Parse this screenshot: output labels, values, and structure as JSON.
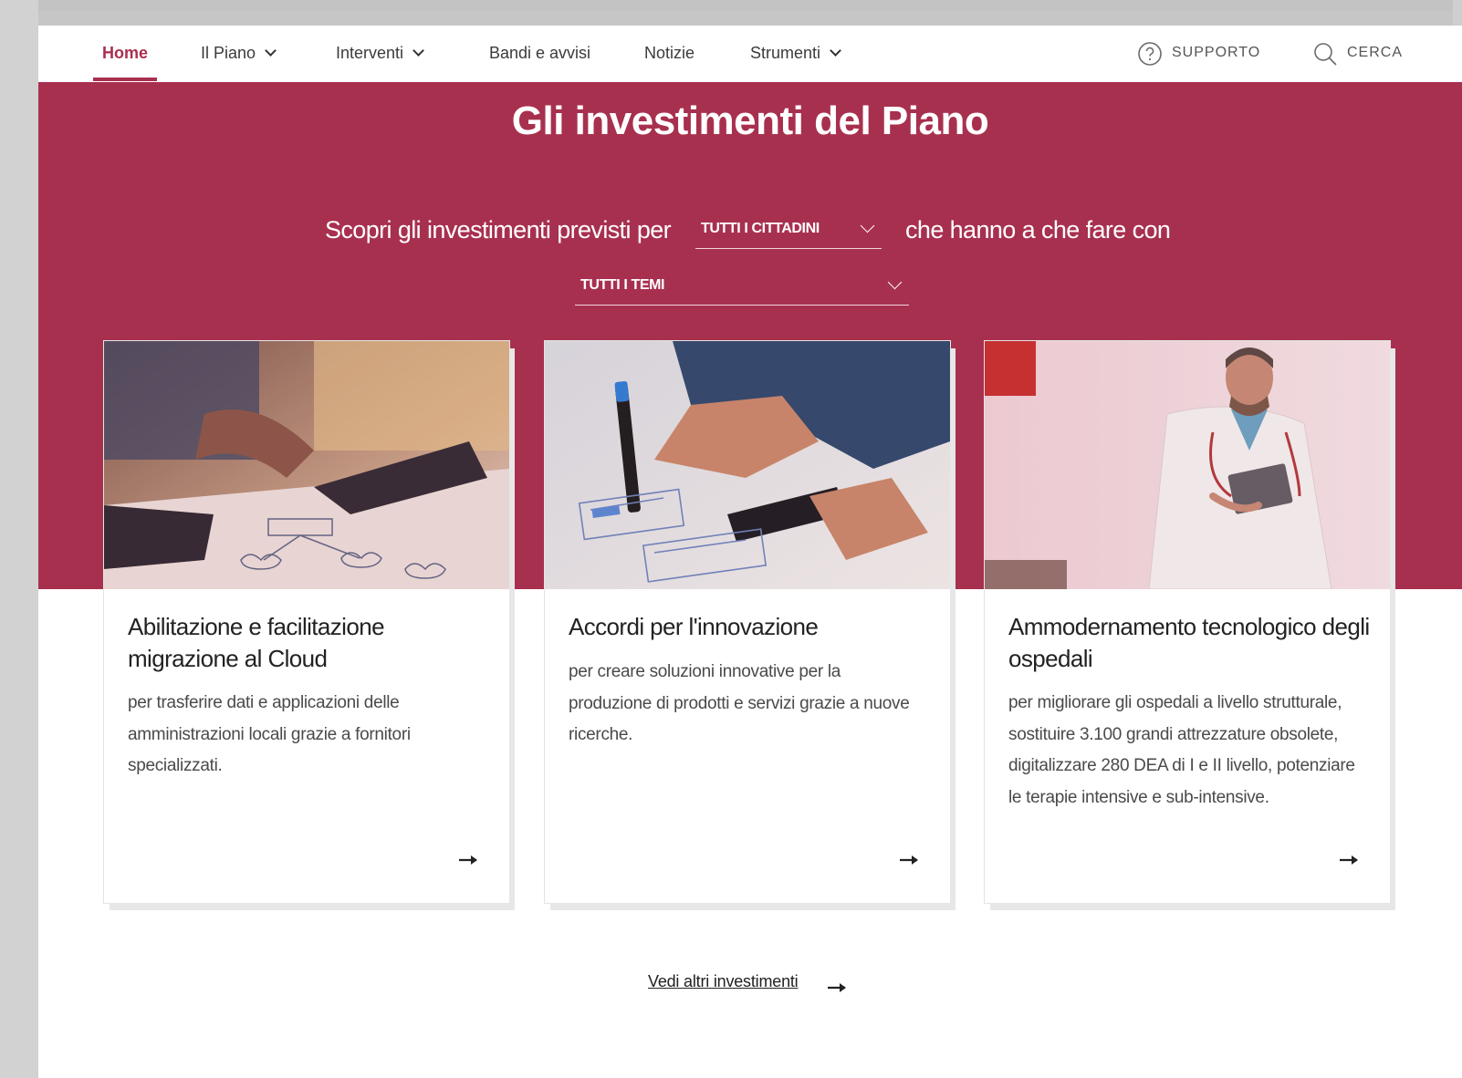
{
  "nav": {
    "items": [
      {
        "label": "Home",
        "active": true,
        "has_dropdown": false
      },
      {
        "label": "Il Piano",
        "has_dropdown": true
      },
      {
        "label": "Interventi",
        "has_dropdown": true
      },
      {
        "label": "Bandi e avvisi",
        "has_dropdown": false
      },
      {
        "label": "Notizie",
        "has_dropdown": false
      },
      {
        "label": "Strumenti",
        "has_dropdown": true
      }
    ],
    "support_label": "SUPPORTO",
    "support_icon": "question-circle-icon",
    "search_label": "CERCA",
    "search_icon": "search-icon"
  },
  "hero": {
    "title": "Gli investimenti del Piano",
    "filter_prefix": "Scopri gli investimenti previsti per",
    "audience_selected": "TUTTI I CITTADINI",
    "filter_middle": "che hanno a che fare con",
    "theme_selected": "TUTTI I TEMI"
  },
  "cards": [
    {
      "title": "Abilitazione e facilitazione migrazione al Cloud",
      "description": "per trasferire dati e applicazioni delle amministrazioni locali grazie a fornitori specializzati.",
      "image": "hands drawing cloud diagram next to laptop"
    },
    {
      "title": "Accordi per l'innovazione",
      "description": "per creare soluzioni innovative per la produzione di prodotti e servizi grazie a nuove ricerche.",
      "image": "hand with marker sketching app wireframes and smartphone"
    },
    {
      "title": "Ammodernamento tecnologico degli ospedali",
      "description": "per migliorare gli ospedali a livello strutturale, sostituire 3.100 grandi attrezzature obsolete, digitalizzare 280 DEA di I e II livello, potenziare le terapie intensive e sub-intensive.",
      "image": "doctor with stethoscope holding a tablet"
    }
  ],
  "more_link": "Vedi altri investimenti",
  "colors": {
    "brand": "#a8304f",
    "text": "#222222",
    "nav_text": "#3b3b3b"
  }
}
